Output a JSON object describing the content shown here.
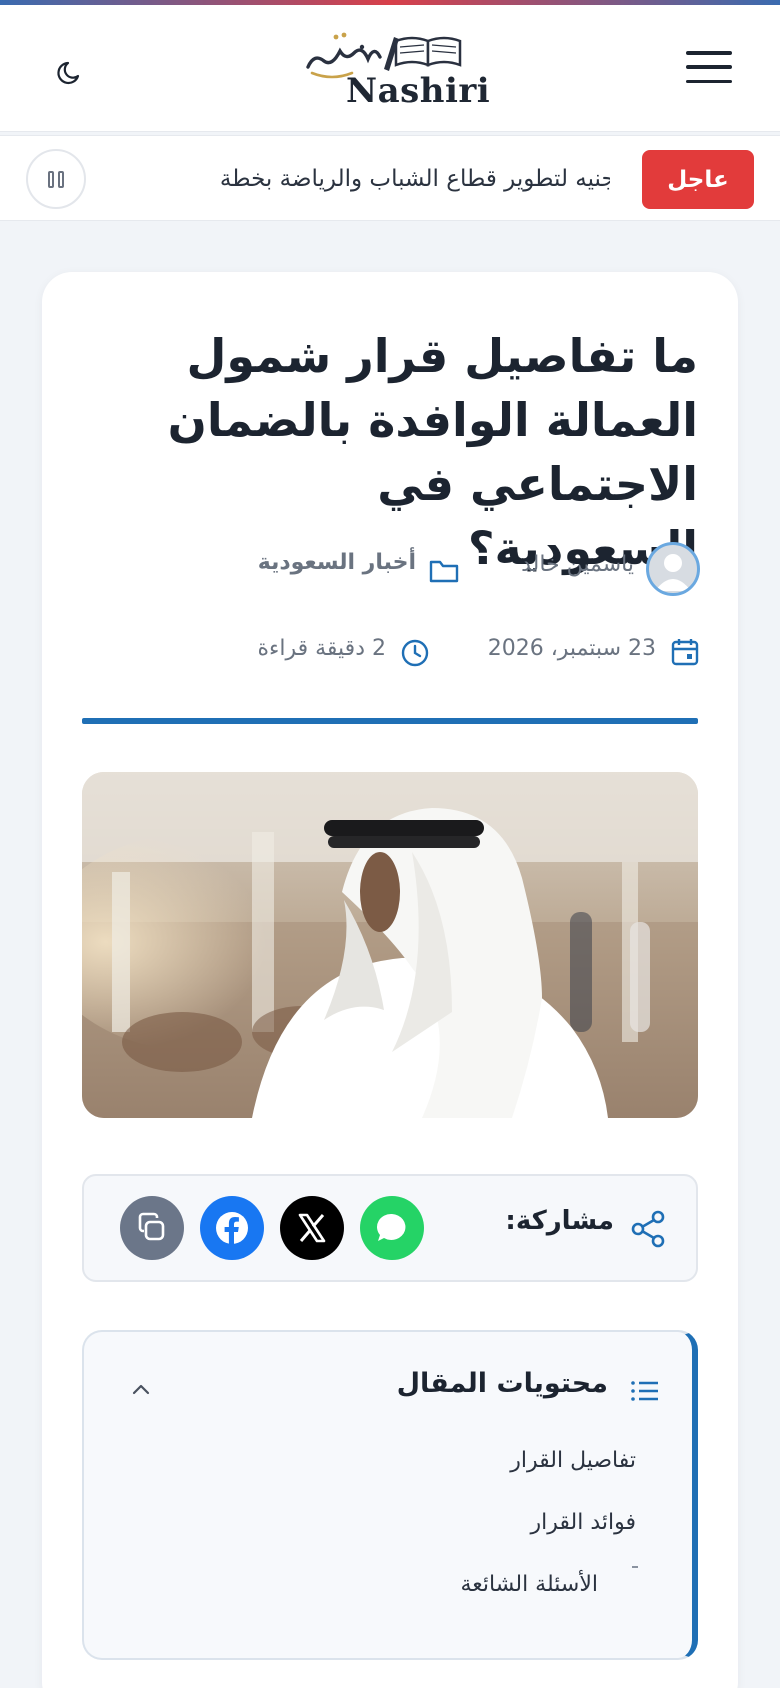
{
  "header": {
    "logo_arabic": "ناشري",
    "logo_latin": "Nashiri"
  },
  "ticker": {
    "badge": "عاجل",
    "text": "مليار جنيه لتطوير قطاع الشباب والرياضة بخطة"
  },
  "article": {
    "title": "ما تفاصيل قرار شمول العمالة الوافدة بالضمان الاجتماعي في السعودية؟",
    "author": "ياسمين خالد",
    "category": "أخبار السعودية",
    "date": "23 سبتمبر، 2026",
    "read_time": "2 دقيقة قراءة"
  },
  "share": {
    "label": "مشاركة:",
    "buttons": [
      {
        "name": "whatsapp",
        "color": "#25d366"
      },
      {
        "name": "x",
        "color": "#000000"
      },
      {
        "name": "facebook",
        "color": "#1877f2"
      },
      {
        "name": "copy",
        "color": "#6b7689"
      }
    ]
  },
  "toc": {
    "title": "محتويات المقال",
    "items": [
      "تفاصيل القرار",
      "فوائد القرار",
      "الأسئلة الشائعة"
    ]
  },
  "colors": {
    "accent": "#1f6fb5",
    "urgent": "#e23b3b"
  }
}
